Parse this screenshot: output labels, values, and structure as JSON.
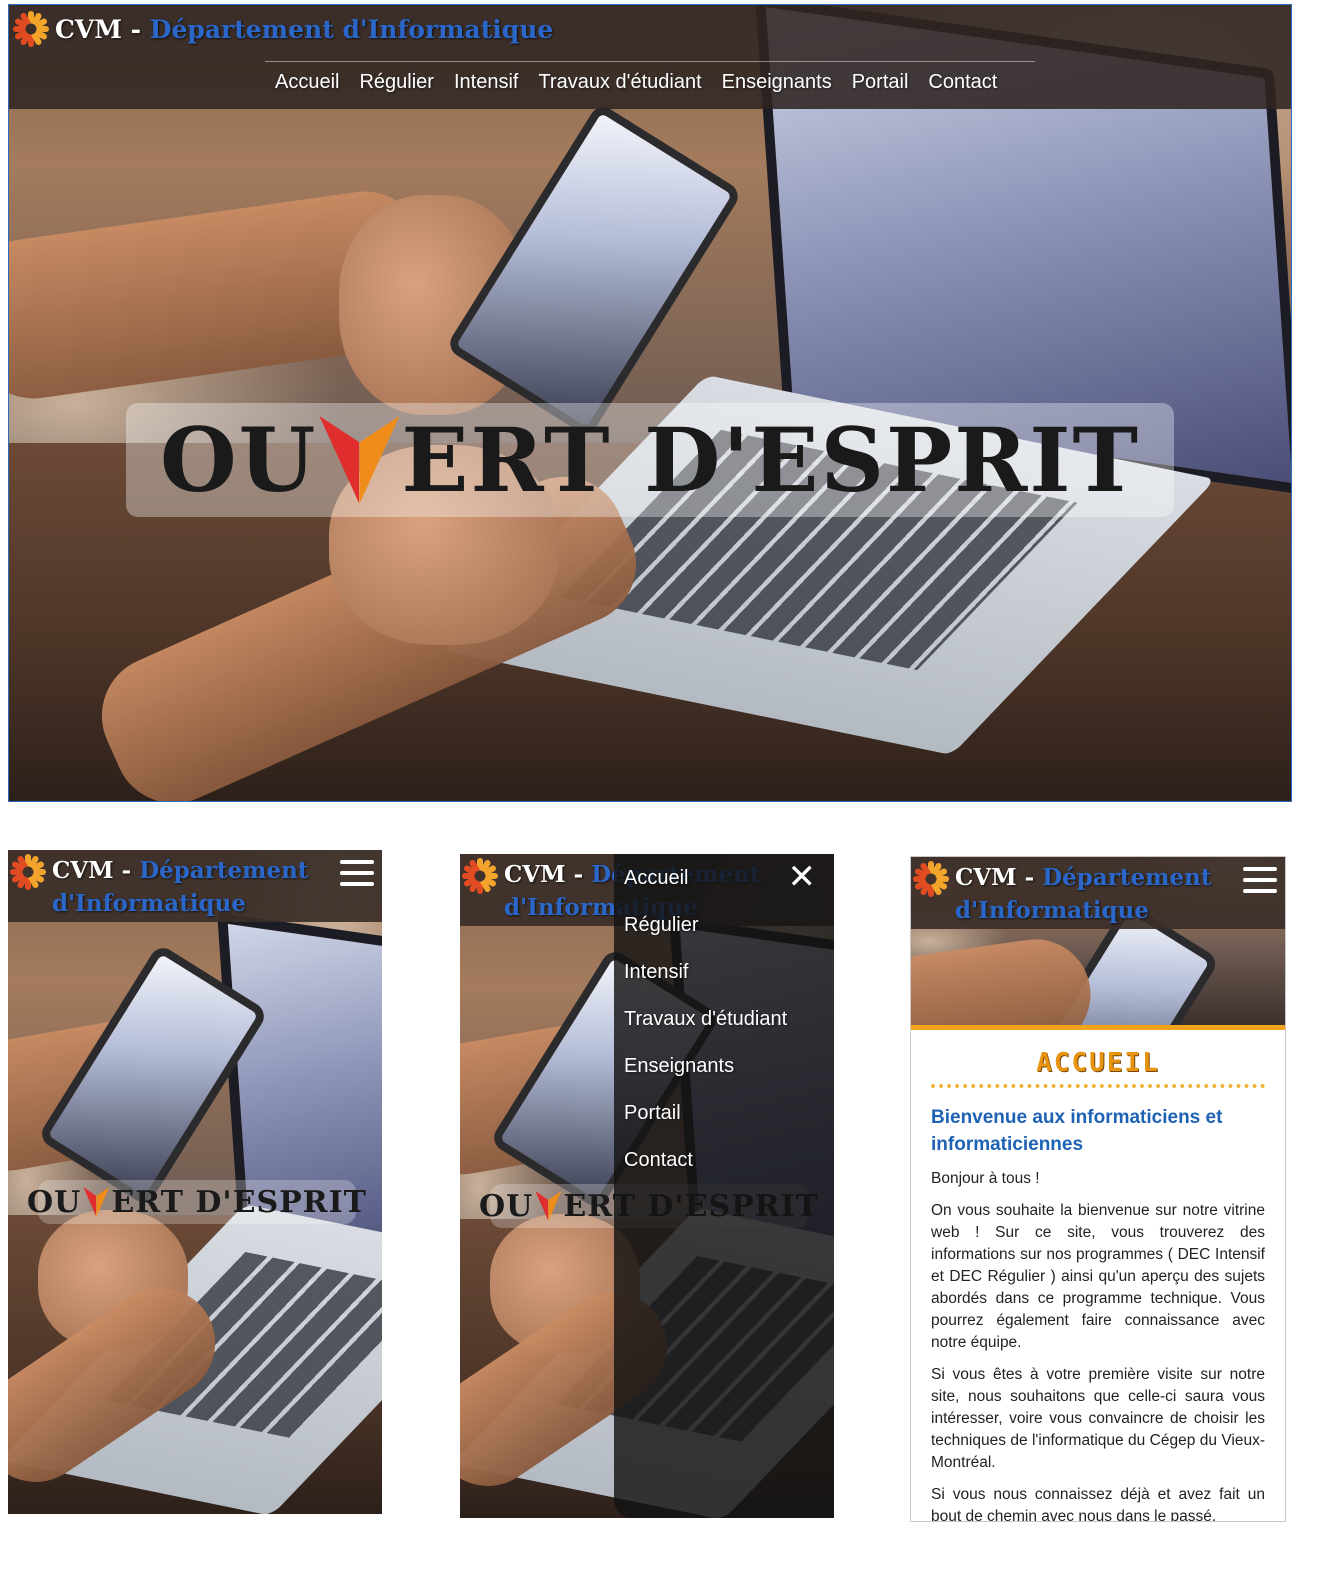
{
  "site": {
    "brand_cvm": "CVM",
    "brand_dash": " - ",
    "brand_dept": "Département d'Informatique",
    "brand_dept_line1": "Département",
    "brand_dept_line2": "d'Informatique",
    "slogan_part1": "OU",
    "slogan_part2": "ERT D'ESPRIT"
  },
  "nav": {
    "items": [
      {
        "label": "Accueil"
      },
      {
        "label": "Régulier"
      },
      {
        "label": "Intensif"
      },
      {
        "label": "Travaux d'étudiant"
      },
      {
        "label": "Enseignants"
      },
      {
        "label": "Portail"
      },
      {
        "label": "Contact"
      }
    ]
  },
  "mobile_menu": {
    "close_icon": "close-icon",
    "toggle_icon": "hamburger-icon"
  },
  "page": {
    "heading": "ACCUEIL",
    "subheading": "Bienvenue aux informaticiens et informaticiennes",
    "paragraphs": [
      "Bonjour à tous !",
      "On vous souhaite la bienvenue sur notre vitrine web ! Sur ce site, vous trouverez des informations sur nos programmes ( DEC Intensif et DEC Régulier ) ainsi qu'un aperçu des sujets abordés dans ce programme technique. Vous pourrez également faire connaissance avec notre équipe.",
      "Si vous êtes à votre première visite sur notre site, nous souhaitons que celle-ci saura vous intéresser, voire vous convaincre de choisir les techniques de l'informatique du Cégep du Vieux-Montréal.",
      "Si vous nous connaissez déjà et avez fait un bout de chemin avec nous dans le passé,"
    ]
  },
  "colors": {
    "brand_blue": "#2a67c9",
    "accent_orange": "#f2a31b",
    "header_bg": "#30262280",
    "heading_blue": "#1d62b5"
  }
}
